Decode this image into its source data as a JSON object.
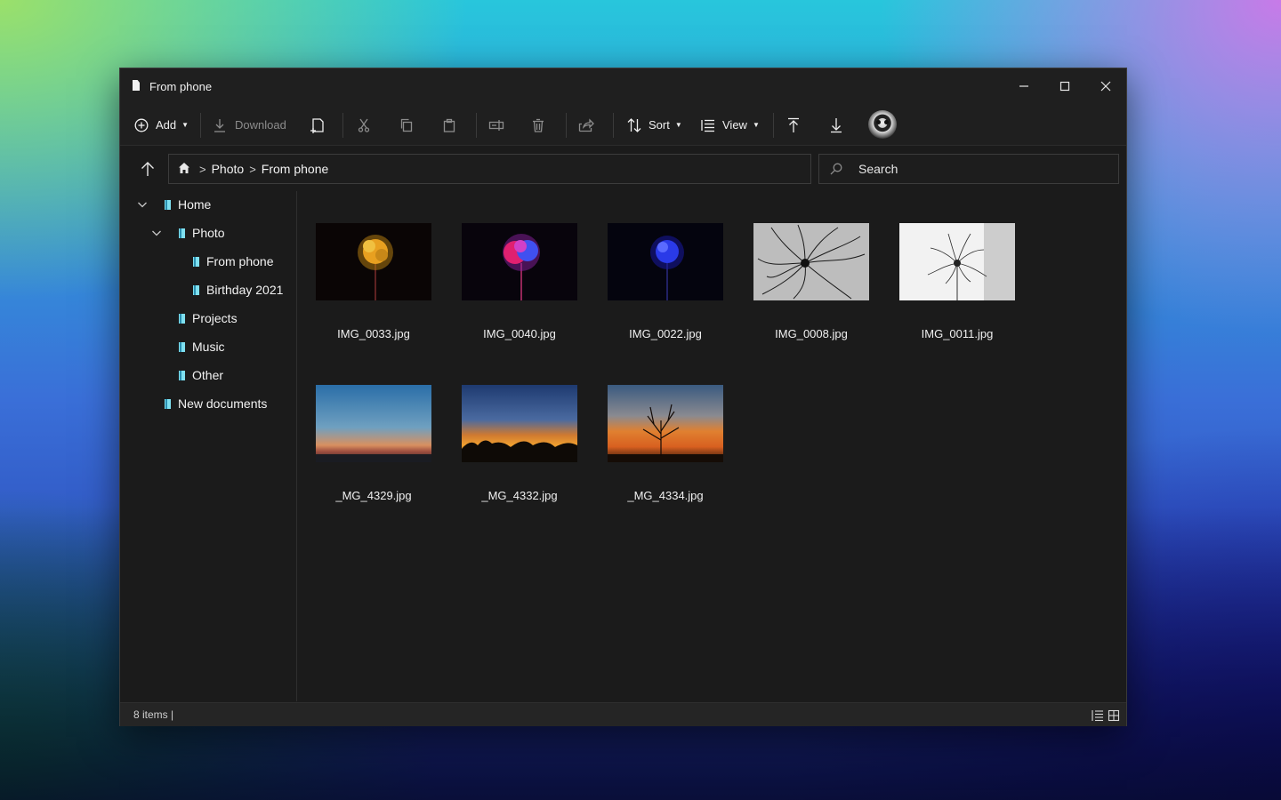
{
  "window": {
    "title": "From phone"
  },
  "toolbar": {
    "add_label": "Add",
    "download_label": "Download",
    "sort_label": "Sort",
    "view_label": "View"
  },
  "address": {
    "crumbs": [
      "Photo",
      "From phone"
    ]
  },
  "search": {
    "placeholder": "Search"
  },
  "sidebar": {
    "items": [
      {
        "label": "Home",
        "expanded": true
      },
      {
        "label": "Photo",
        "expanded": true
      },
      {
        "label": "From phone",
        "selected": true
      },
      {
        "label": "Birthday 2021"
      },
      {
        "label": "Projects"
      },
      {
        "label": "Music"
      },
      {
        "label": "Other"
      },
      {
        "label": "New documents"
      }
    ]
  },
  "files": [
    {
      "name": "IMG_0033.jpg",
      "thumb": "gold-flower"
    },
    {
      "name": "IMG_0040.jpg",
      "thumb": "pink-blue-flower"
    },
    {
      "name": "IMG_0022.jpg",
      "thumb": "blue-flower"
    },
    {
      "name": "IMG_0008.jpg",
      "thumb": "bw-fronds-grey"
    },
    {
      "name": "IMG_0011.jpg",
      "thumb": "bw-fronds-white"
    },
    {
      "name": "_MG_4329.jpg",
      "thumb": "blue-sunset"
    },
    {
      "name": "_MG_4332.jpg",
      "thumb": "orange-sunset"
    },
    {
      "name": "_MG_4334.jpg",
      "thumb": "tree-sunset"
    }
  ],
  "status": {
    "items_text": "8 items |"
  },
  "colors": {
    "window_bg": "#1b1b1b",
    "accent_folder": "#7fe0f0"
  }
}
